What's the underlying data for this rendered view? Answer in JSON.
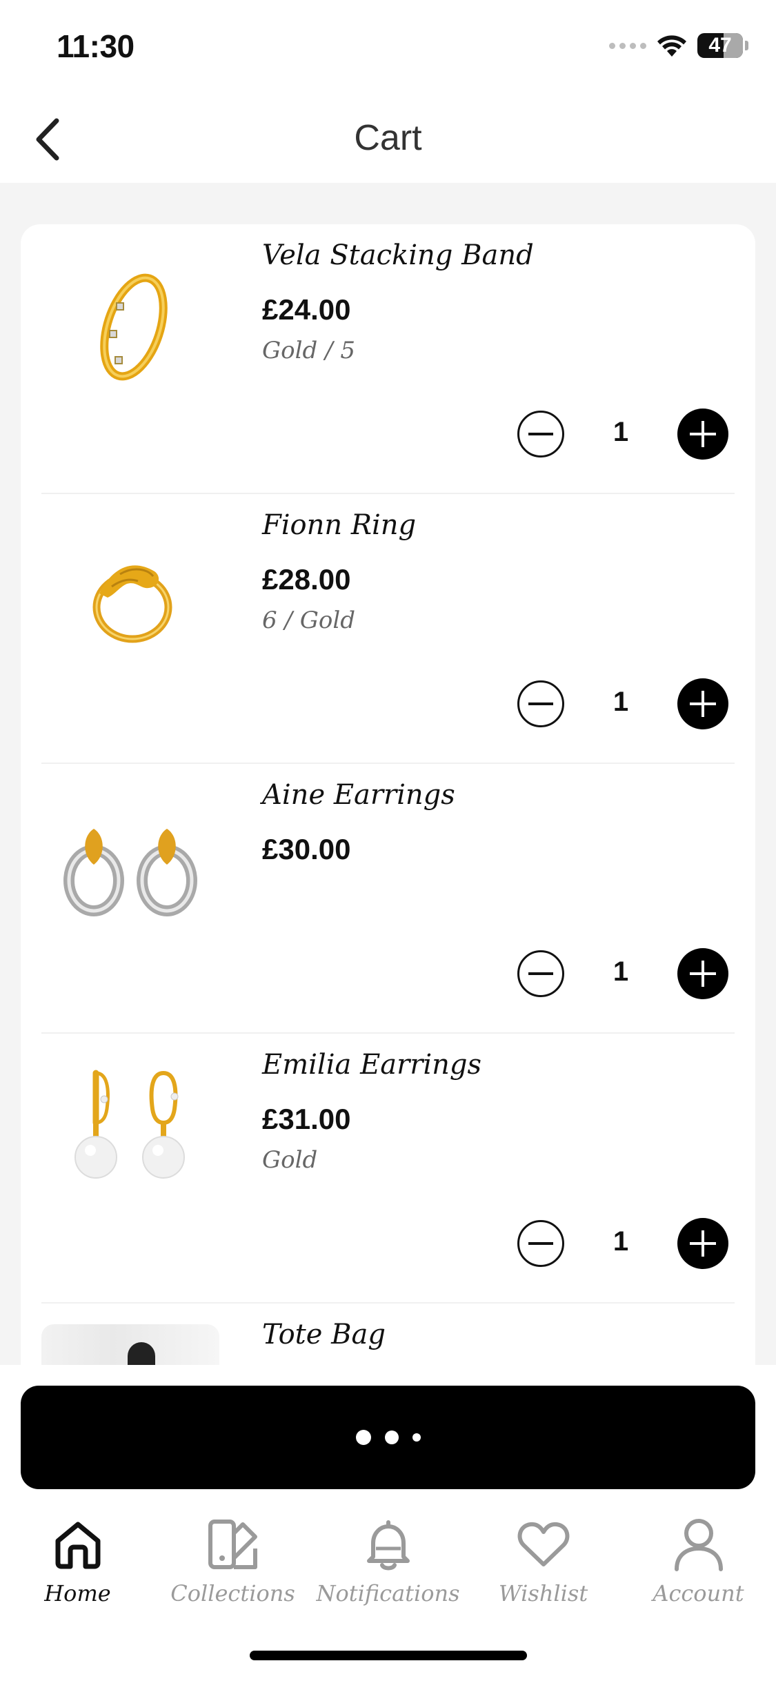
{
  "status_bar": {
    "time": "11:30",
    "battery": "47",
    "icons": [
      "cellular-icon",
      "wifi-icon",
      "battery-icon"
    ]
  },
  "nav": {
    "title": "Cart",
    "back_icon": "chevron-left-icon"
  },
  "cart": {
    "items": [
      {
        "name": "Vela Stacking Band",
        "price": "£24.00",
        "variant": "Gold / 5",
        "quantity": "1",
        "image": "gold-ring-with-stones"
      },
      {
        "name": "Fionn Ring",
        "price": "£28.00",
        "variant": "6 / Gold",
        "quantity": "1",
        "image": "gold-hands-ring"
      },
      {
        "name": "Aine Earrings",
        "price": "£30.00",
        "variant": "",
        "quantity": "1",
        "image": "silver-gold-earrings"
      },
      {
        "name": "Emilia Earrings",
        "price": "£31.00",
        "variant": "Gold",
        "quantity": "1",
        "image": "pearl-hoop-earrings"
      },
      {
        "name": "Tote Bag",
        "image": "tote-bag-photo"
      }
    ],
    "qty_icons": {
      "minus": "minus-circle-icon",
      "plus": "plus-circle-icon"
    }
  },
  "checkout": {
    "state": "loading",
    "icon": "loading-dots-icon"
  },
  "tabs": [
    {
      "label": "Home",
      "icon": "home-icon",
      "active": true
    },
    {
      "label": "Collections",
      "icon": "collections-icon",
      "active": false
    },
    {
      "label": "Notifications",
      "icon": "bell-icon",
      "active": false
    },
    {
      "label": "Wishlist",
      "icon": "heart-icon",
      "active": false
    },
    {
      "label": "Account",
      "icon": "user-icon",
      "active": false
    }
  ],
  "colors": {
    "background": "#f4f4f4",
    "surface": "#ffffff",
    "accent": "#000000",
    "muted": "#9a9a9a",
    "gold": "#e8a91c"
  }
}
